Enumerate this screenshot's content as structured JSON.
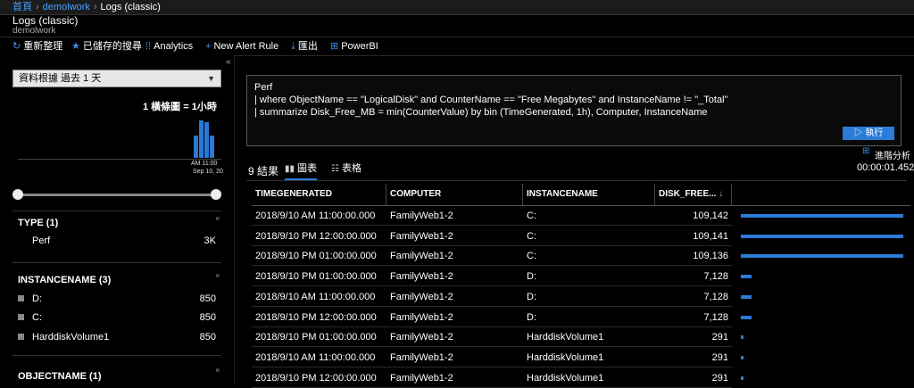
{
  "breadcrumb": {
    "home": "首頁",
    "workspace": "demolwork",
    "current": "Logs (classic)"
  },
  "title": "Logs (classic)",
  "subtitle": "demolwork",
  "toolbar": {
    "refresh": "重新整理",
    "saved": "已儲存的搜尋",
    "analytics": "Analytics",
    "alert": "New Alert Rule",
    "export": "匯出",
    "powerbi": "PowerBI"
  },
  "time_select": "資料根據 過去 1 天",
  "histogram": {
    "bin_label": "1 橫條圖 = 1小時",
    "x_label_line1": "AM 11:00",
    "x_label_line2": "Sep 10, 20",
    "bar_values": [
      0.6,
      1.0,
      0.95,
      0.6
    ],
    "accent_color": "#2b79d3"
  },
  "facets": [
    {
      "title": "TYPE (1)",
      "items": [
        {
          "label": "Perf",
          "count": "3K",
          "checkbox": false
        }
      ]
    },
    {
      "title": "INSTANCENAME (3)",
      "items": [
        {
          "label": "D:",
          "count": "850",
          "checkbox": true
        },
        {
          "label": "C:",
          "count": "850",
          "checkbox": true
        },
        {
          "label": "HarddiskVolume1",
          "count": "850",
          "checkbox": true
        }
      ]
    },
    {
      "title": "OBJECTNAME (1)",
      "items": []
    }
  ],
  "query": {
    "line1": "Perf",
    "line2": "| where ObjectName == \"LogicalDisk\" and CounterName == \"Free Megabytes\" and InstanceName != \"_Total\"",
    "line3": "| summarize Disk_Free_MB = min(CounterValue) by bin (TimeGenerated, 1h), Computer, InstanceName"
  },
  "run_label": "執行",
  "advanced_label": "進階分析",
  "exec_time": "00:00:01.452",
  "results_count": "9 結果",
  "tabs": {
    "chart": "圖表",
    "table": "表格"
  },
  "table": {
    "columns": [
      "TIMEGENERATED",
      "COMPUTER",
      "INSTANCENAME",
      "DISK_FREE..."
    ],
    "rows": [
      {
        "time": "2018/9/10 AM 11:00:00.000",
        "computer": "FamilyWeb1-2",
        "instance": "C:",
        "disk": "109,142",
        "value": 109142
      },
      {
        "time": "2018/9/10 PM 12:00:00.000",
        "computer": "FamilyWeb1-2",
        "instance": "C:",
        "disk": "109,141",
        "value": 109141
      },
      {
        "time": "2018/9/10 PM 01:00:00.000",
        "computer": "FamilyWeb1-2",
        "instance": "C:",
        "disk": "109,136",
        "value": 109136
      },
      {
        "time": "2018/9/10 PM 01:00:00.000",
        "computer": "FamilyWeb1-2",
        "instance": "D:",
        "disk": "7,128",
        "value": 7128
      },
      {
        "time": "2018/9/10 AM 11:00:00.000",
        "computer": "FamilyWeb1-2",
        "instance": "D:",
        "disk": "7,128",
        "value": 7128
      },
      {
        "time": "2018/9/10 PM 12:00:00.000",
        "computer": "FamilyWeb1-2",
        "instance": "D:",
        "disk": "7,128",
        "value": 7128
      },
      {
        "time": "2018/9/10 PM 01:00:00.000",
        "computer": "FamilyWeb1-2",
        "instance": "HarddiskVolume1",
        "disk": "291",
        "value": 291
      },
      {
        "time": "2018/9/10 AM 11:00:00.000",
        "computer": "FamilyWeb1-2",
        "instance": "HarddiskVolume1",
        "disk": "291",
        "value": 291
      },
      {
        "time": "2018/9/10 PM 12:00:00.000",
        "computer": "FamilyWeb1-2",
        "instance": "HarddiskVolume1",
        "disk": "291",
        "value": 291
      }
    ]
  }
}
